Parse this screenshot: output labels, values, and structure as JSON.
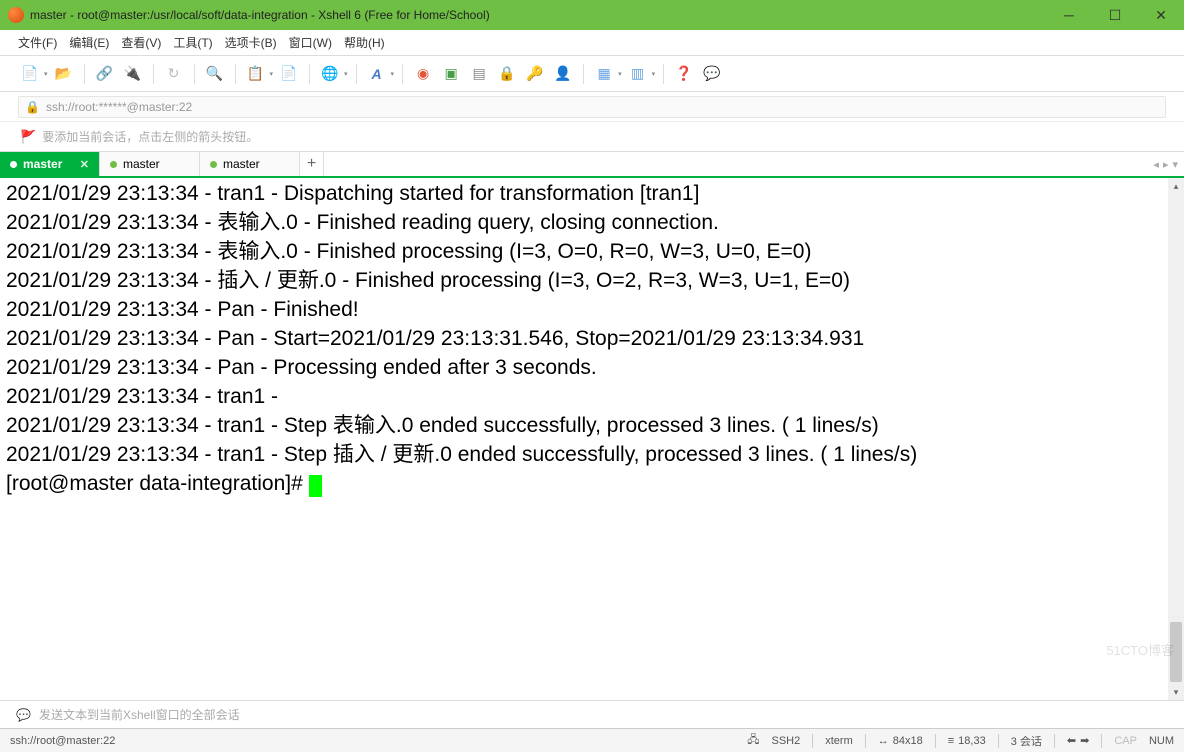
{
  "window": {
    "title": "master - root@master:/usr/local/soft/data-integration - Xshell 6 (Free for Home/School)"
  },
  "menu": {
    "file": "文件(F)",
    "edit": "编辑(E)",
    "view": "查看(V)",
    "tools": "工具(T)",
    "tabs": "选项卡(B)",
    "window": "窗口(W)",
    "help": "帮助(H)"
  },
  "address": {
    "text": "ssh://root:******@master:22"
  },
  "hint": {
    "text": "要添加当前会话，点击左侧的箭头按钮。"
  },
  "tabs": [
    "master",
    "master",
    "master"
  ],
  "terminal_lines": [
    "2021/01/29 23:13:34 - tran1 - Dispatching started for transformation [tran1]",
    "2021/01/29 23:13:34 - 表输入.0 - Finished reading query, closing connection.",
    "2021/01/29 23:13:34 - 表输入.0 - Finished processing (I=3, O=0, R=0, W=3, U=0, E=0)",
    "2021/01/29 23:13:34 - 插入 / 更新.0 - Finished processing (I=3, O=2, R=3, W=3, U=1, E=0)",
    "2021/01/29 23:13:34 - Pan - Finished!",
    "2021/01/29 23:13:34 - Pan - Start=2021/01/29 23:13:31.546, Stop=2021/01/29 23:13:34.931",
    "2021/01/29 23:13:34 - Pan - Processing ended after 3 seconds.",
    "2021/01/29 23:13:34 - tran1 - ",
    "2021/01/29 23:13:34 - tran1 - Step 表输入.0 ended successfully, processed 3 lines. ( 1 lines/s)",
    "2021/01/29 23:13:34 - tran1 - Step 插入 / 更新.0 ended successfully, processed 3 lines. ( 1 lines/s)"
  ],
  "prompt": "[root@master data-integration]# ",
  "sendbar": {
    "placeholder": "发送文本到当前Xshell窗口的全部会话"
  },
  "status": {
    "conn": "ssh://root@master:22",
    "proto": "SSH2",
    "term": "xterm",
    "size": "84x18",
    "pos": "18,33",
    "sessions": "3 会话",
    "cap": "CAP",
    "num": "NUM"
  },
  "watermark": "51CTO博客"
}
